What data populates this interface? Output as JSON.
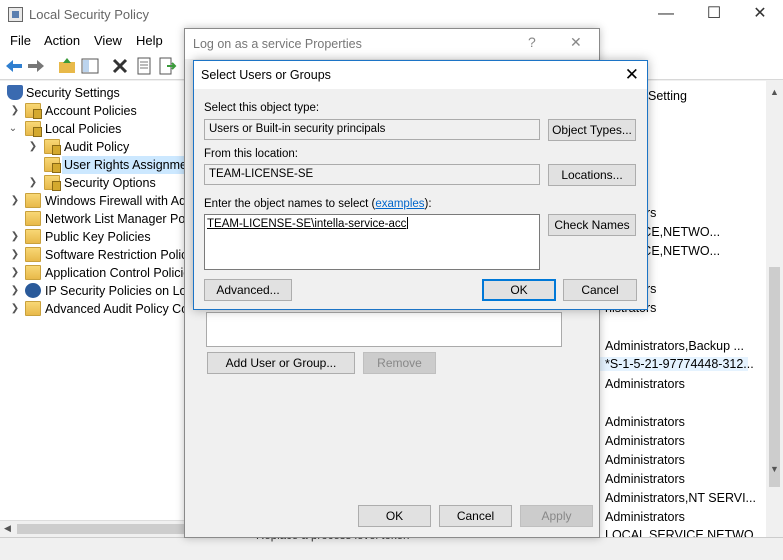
{
  "main_window": {
    "title": "Local Security Policy",
    "window_controls": {
      "minimize": "—",
      "maximize": "☐",
      "close": "✕"
    },
    "menu": [
      "File",
      "Action",
      "View",
      "Help"
    ]
  },
  "tree": {
    "items": [
      {
        "label": "Security Settings",
        "icon": "security-settings-icon"
      },
      {
        "label": "Account Policies",
        "icon": "folder-lock-icon"
      },
      {
        "label": "Local Policies",
        "icon": "folder-lock-icon"
      },
      {
        "label": "Audit Policy",
        "icon": "folder-lock-icon"
      },
      {
        "label": "User Rights Assignment",
        "icon": "folder-open-icon"
      },
      {
        "label": "Security Options",
        "icon": "folder-lock-icon"
      },
      {
        "label": "Windows Firewall with Adv",
        "icon": "folder-icon"
      },
      {
        "label": "Network List Manager Poli",
        "icon": "folder-icon"
      },
      {
        "label": "Public Key Policies",
        "icon": "folder-icon"
      },
      {
        "label": "Software Restriction Polic",
        "icon": "folder-icon"
      },
      {
        "label": "Application Control Policie",
        "icon": "folder-icon"
      },
      {
        "label": "IP Security Policies on Loca",
        "icon": "ip-security-icon"
      },
      {
        "label": "Advanced Audit Policy Co",
        "icon": "folder-icon"
      }
    ]
  },
  "right_pane": {
    "column_header": "Setting",
    "items": [
      "nistrators",
      "SERVICE,NETWO...",
      "SERVICE,NETWO...",
      "nistrators",
      "nistrators",
      "Administrators,Backup ...",
      "*S-1-5-21-97774448-312...",
      "Administrators",
      "Administrators",
      "Administrators",
      "Administrators",
      "Administrators",
      "Administrators,NT SERVI...",
      "Administrators",
      "LOCAL SERVICE,NETWO"
    ],
    "partial_bottom": "Replace a process level token"
  },
  "properties_dialog": {
    "title": "Log on as a service Properties",
    "help": "?",
    "close": "✕",
    "add_button": "Add User or Group...",
    "remove_button": "Remove",
    "ok": "OK",
    "cancel": "Cancel",
    "apply": "Apply"
  },
  "select_dialog": {
    "title": "Select Users or Groups",
    "close": "✕",
    "object_type_label": "Select this object type:",
    "object_type_value": "Users or Built-in security principals",
    "object_types_button": "Object Types...",
    "location_label": "From this location:",
    "location_value": "TEAM-LICENSE-SE",
    "locations_button": "Locations...",
    "names_label_prefix": "Enter the object names to select (",
    "names_label_link": "examples",
    "names_label_suffix": "):",
    "names_value": "TEAM-LICENSE-SE\\intella-service-acc",
    "check_names_button": "Check Names",
    "advanced_button": "Advanced...",
    "ok": "OK",
    "cancel": "Cancel"
  }
}
